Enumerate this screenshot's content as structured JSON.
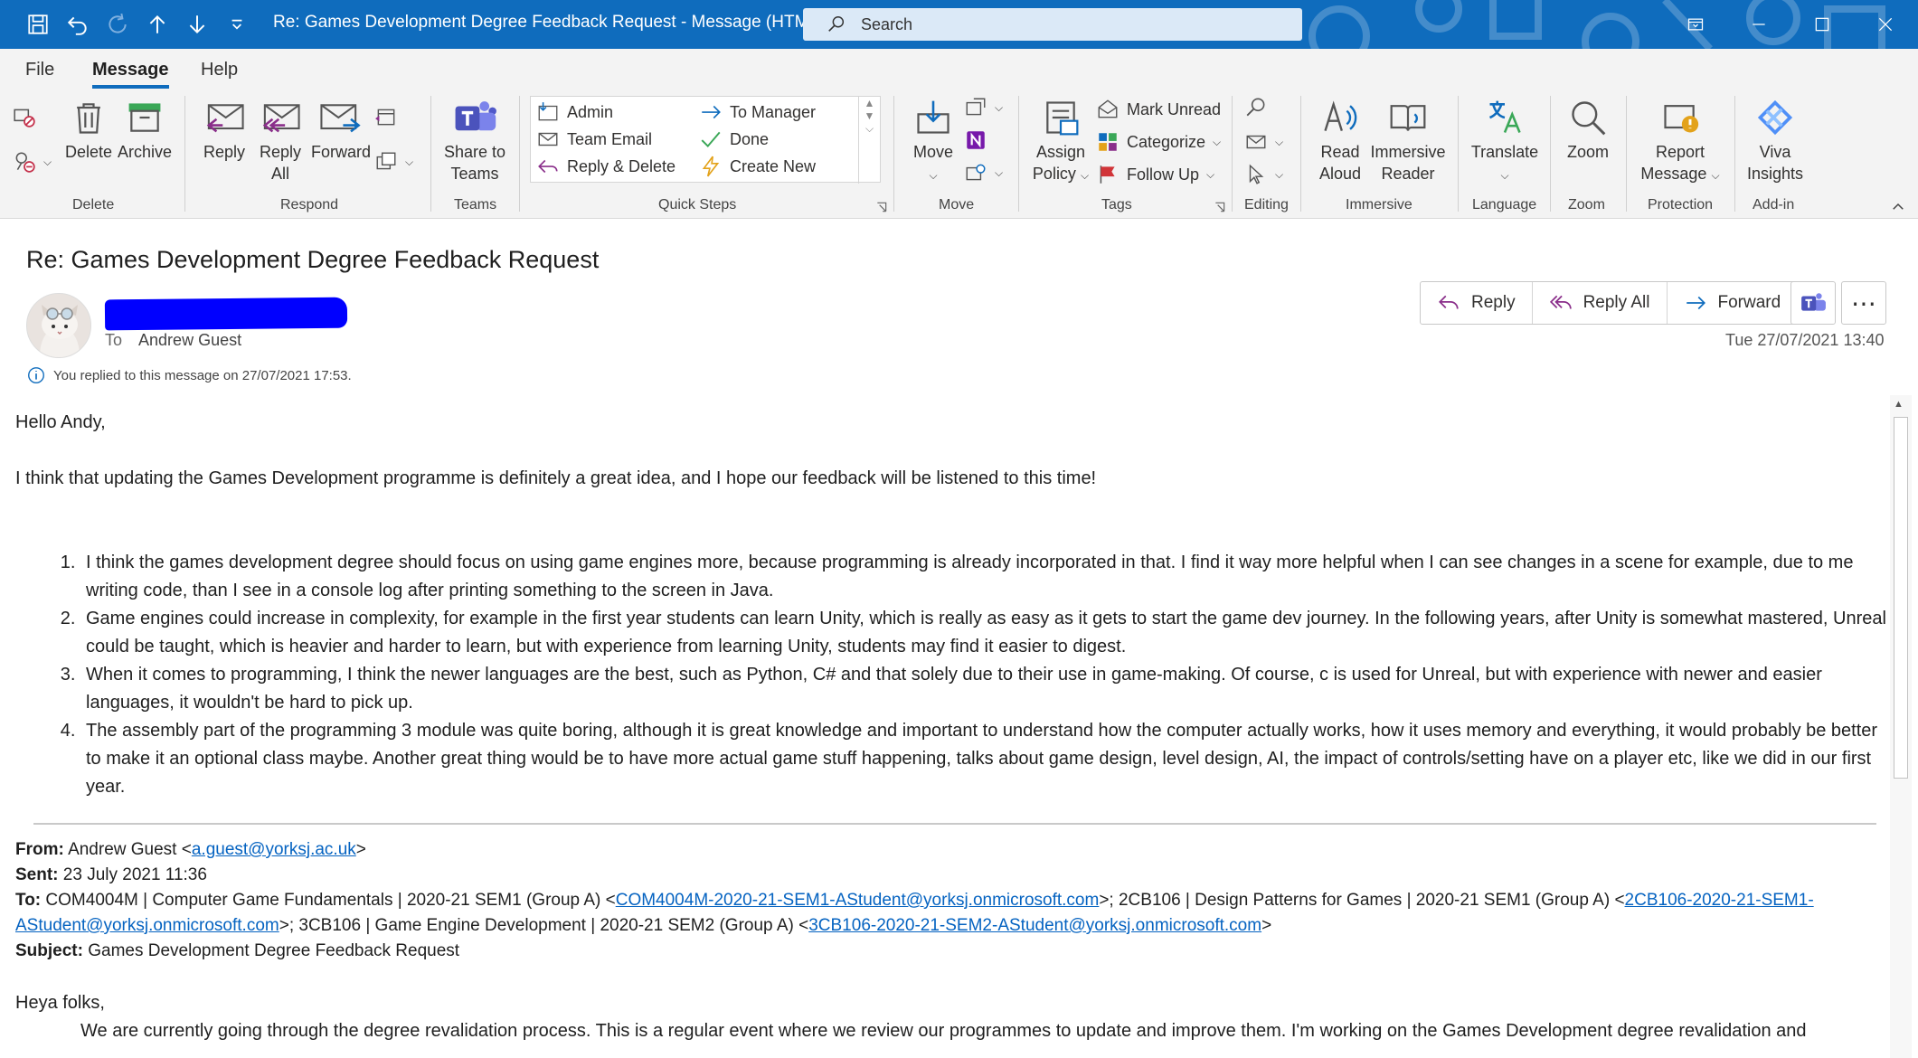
{
  "window": {
    "title": "Re: Games Development Degree Feedback Request  -  Message (HTML)",
    "search_placeholder": "Search"
  },
  "menu": {
    "tabs": [
      {
        "label": "File"
      },
      {
        "label": "Message"
      },
      {
        "label": "Help"
      }
    ]
  },
  "ribbon": {
    "delete": {
      "delete_label": "Delete",
      "archive_label": "Archive",
      "group": "Delete"
    },
    "respond": {
      "reply_label": "Reply",
      "reply_all_label_1": "Reply",
      "reply_all_label_2": "All",
      "forward_label": "Forward",
      "group": "Respond"
    },
    "teams": {
      "share_label_1": "Share to",
      "share_label_2": "Teams",
      "group": "Teams"
    },
    "quick_steps": {
      "items": [
        "Admin",
        "To Manager",
        "Team Email",
        "Done",
        "Reply & Delete",
        "Create New"
      ],
      "group": "Quick Steps"
    },
    "move": {
      "move_label": "Move",
      "group": "Move"
    },
    "tags": {
      "assign_label_1": "Assign",
      "assign_label_2": "Policy",
      "mark_unread": "Mark Unread",
      "categorize": "Categorize",
      "follow_up": "Follow Up",
      "group": "Tags"
    },
    "editing": {
      "group": "Editing"
    },
    "immersive": {
      "read_aloud_1": "Read",
      "read_aloud_2": "Aloud",
      "reader_1": "Immersive",
      "reader_2": "Reader",
      "group": "Immersive"
    },
    "language": {
      "translate_label": "Translate",
      "group": "Language"
    },
    "zoom": {
      "zoom_label": "Zoom",
      "group": "Zoom"
    },
    "protection": {
      "report_1": "Report",
      "report_2": "Message",
      "group": "Protection"
    },
    "addin": {
      "viva_1": "Viva",
      "viva_2": "Insights",
      "group": "Add-in"
    }
  },
  "message": {
    "subject": "Re: Games Development Degree Feedback Request",
    "to_label": "To",
    "to_name": "Andrew Guest",
    "replied_notice": "You replied to this message on 27/07/2021 17:53.",
    "date": "Tue 27/07/2021 13:40",
    "actions": {
      "reply": "Reply",
      "reply_all": "Reply All",
      "forward": "Forward"
    },
    "greeting": "Hello Andy,",
    "intro": "I think that updating the Games Development programme is definitely a great idea, and I hope our feedback will be listened to this time!",
    "points": [
      "I think the games development degree should focus on using game engines more, because programming is already incorporated in that. I find it way more helpful when I can see changes in a scene for example, due to me writing code, than I see in a console log after printing something to the screen in Java.",
      "Game engines could increase in complexity, for example in the first year students can learn Unity, which is really as easy as it gets to start the game dev journey. In the following years, after Unity is somewhat mastered, Unreal could be taught, which is heavier and harder to learn, but with experience from learning Unity, students may find it easier to digest.",
      "When it comes to programming, I think the newer languages are the best, such as Python, C# and that solely due to their use in game-making. Of course, c is used for Unreal, but with experience with newer and easier languages, it wouldn't be hard to pick up.",
      "The assembly part of the programming 3 module was quite boring, although it is great knowledge and important to understand how the computer actually works, how it uses memory and everything, it would probably be better to make it an optional class maybe. Another great thing would be to have more actual game stuff happening, talks about game design, level design, AI, the impact of controls/setting have on a player etc, like we did in our first year."
    ],
    "quoted": {
      "from_label": "From:",
      "from_name": "Andrew Guest <",
      "from_email": "a.guest@yorksj.ac.uk",
      "from_close": ">",
      "sent_label": "Sent:",
      "sent_value": "23 July 2021 11:36",
      "to_label": "To:",
      "to_part1": "COM4004M | Computer Game Fundamentals | 2020-21 SEM1 (Group A) <",
      "to_email1": "COM4004M-2020-21-SEM1-AStudent@yorksj.onmicrosoft.com",
      "to_part2": ">; 2CB106 | Design Patterns for Games | 2020-21 SEM1 (Group A) <",
      "to_email2": "2CB106-2020-21-SEM1-AStudent@yorksj.onmicrosoft.com",
      "to_part3": ">; 3CB106 | Game Engine Development | 2020-21 SEM2 (Group A) <",
      "to_email3": "3CB106-2020-21-SEM2-AStudent@yorksj.onmicrosoft.com",
      "to_close": ">",
      "subject_label": "Subject:",
      "subject_value": "Games Development Degree Feedback Request",
      "greeting": "Heya folks,",
      "partial_line": "We are currently going through the degree revalidation process. This is a regular event where we review our programmes to update and improve them. I'm working on the Games Development degree revalidation and"
    }
  },
  "colors": {
    "accent": "#0f6cbd",
    "link": "#0563c1",
    "redaction": "#0000ff"
  }
}
